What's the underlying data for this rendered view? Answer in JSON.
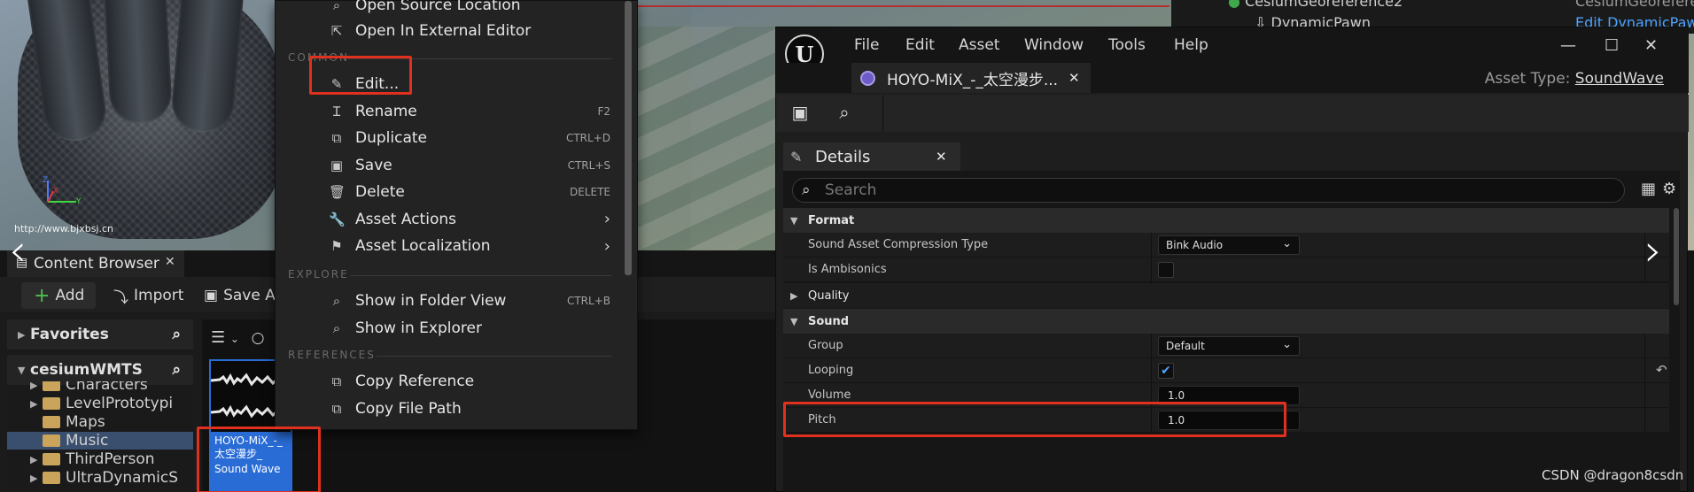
{
  "viewport": {
    "watermark_url": "http://www.bjxbsj.cn",
    "axis": {
      "x": "X",
      "y": "Y",
      "z": "Z"
    }
  },
  "outliner": {
    "row1_name": "CesiumGeoreference2",
    "row1_type": "CesiumGeoreference",
    "row2_name": "DynamicPawn",
    "row2_link": "Edit DynamicPaw"
  },
  "content_browser": {
    "tab_label": "Content Browser",
    "toolbar": {
      "add_label": "Add",
      "import_label": "Import",
      "save_label": "Save Al"
    },
    "favorites_label": "Favorites",
    "project_label": "cesiumWMTS",
    "tree": [
      {
        "label": "Characters",
        "expandable": true
      },
      {
        "label": "LevelPrototypi",
        "expandable": true
      },
      {
        "label": "Maps",
        "expandable": false
      },
      {
        "label": "Music",
        "expandable": false,
        "selected": true
      },
      {
        "label": "ThirdPerson",
        "expandable": true
      },
      {
        "label": "UltraDynamicS",
        "expandable": true
      }
    ],
    "asset": {
      "name_line1": "HOYO-MiX_-_",
      "name_line2": "太空漫步_",
      "type": "Sound Wave"
    }
  },
  "context_menu": {
    "top_items": [
      {
        "label": "Open Source Location",
        "icon": "folder-search-icon"
      },
      {
        "label": "Open In External Editor",
        "icon": "external-editor-icon"
      }
    ],
    "sections": [
      {
        "title": "COMMON"
      },
      {
        "title": "EXPLORE"
      },
      {
        "title": "REFERENCES"
      }
    ],
    "common_items": [
      {
        "label": "Edit...",
        "shortcut": "",
        "icon": "pencil-icon"
      },
      {
        "label": "Rename",
        "shortcut": "F2",
        "icon": "rename-icon"
      },
      {
        "label": "Duplicate",
        "shortcut": "CTRL+D",
        "icon": "duplicate-icon"
      },
      {
        "label": "Save",
        "shortcut": "CTRL+S",
        "icon": "save-icon"
      },
      {
        "label": "Delete",
        "shortcut": "DELETE",
        "icon": "trash-icon"
      },
      {
        "label": "Asset Actions",
        "shortcut": "",
        "icon": "wrench-icon",
        "submenu": true
      },
      {
        "label": "Asset Localization",
        "shortcut": "",
        "icon": "flag-icon",
        "submenu": true
      }
    ],
    "explore_items": [
      {
        "label": "Show in Folder View",
        "shortcut": "CTRL+B",
        "icon": "folder-view-icon"
      },
      {
        "label": "Show in Explorer",
        "shortcut": "",
        "icon": "explorer-icon"
      }
    ],
    "reference_items": [
      {
        "label": "Copy Reference",
        "shortcut": "",
        "icon": "copy-icon"
      },
      {
        "label": "Copy File Path",
        "shortcut": "",
        "icon": "copy-path-icon"
      }
    ]
  },
  "editor": {
    "menu": [
      "File",
      "Edit",
      "Asset",
      "Window",
      "Tools",
      "Help"
    ],
    "asset_tab_label": "HOYO-MiX_-_太空漫步...",
    "asset_type_prefix": "Asset Type:",
    "asset_type_value": "SoundWave",
    "details_tab_label": "Details",
    "search_placeholder": "Search",
    "categories": {
      "format": "Format",
      "quality": "Quality",
      "sound": "Sound"
    },
    "properties": {
      "compression_label": "Sound Asset Compression Type",
      "compression_value": "Bink Audio",
      "ambisonics_label": "Is Ambisonics",
      "ambisonics_value": false,
      "group_label": "Group",
      "group_value": "Default",
      "looping_label": "Looping",
      "looping_value": true,
      "volume_label": "Volume",
      "volume_value": "1.0",
      "pitch_label": "Pitch",
      "pitch_value": "1.0"
    }
  },
  "footer": {
    "credit": "CSDN @dragon8csdn"
  },
  "colors": {
    "highlight": "#e0301e",
    "selection": "#2a6cd6",
    "accent_link": "#4da3ff"
  }
}
